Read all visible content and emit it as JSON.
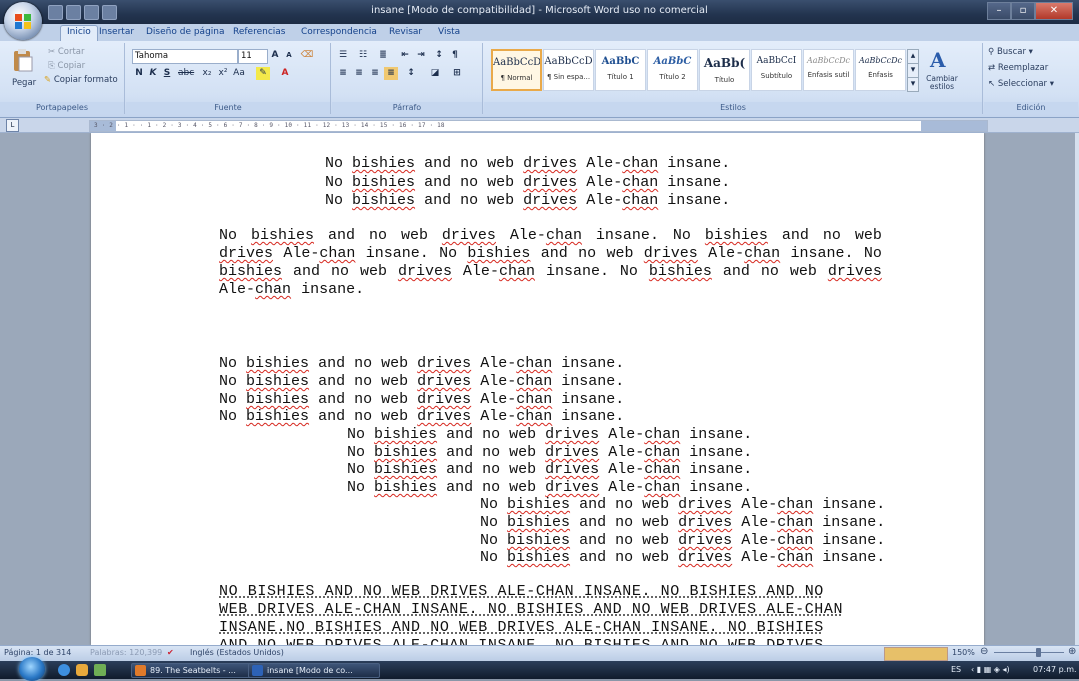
{
  "window": {
    "title": "insane [Modo de compatibilidad] - Microsoft Word uso no comercial",
    "controls": [
      "minimize-icon",
      "maximize-icon",
      "close-icon"
    ]
  },
  "tabs": [
    {
      "label": "Inicio",
      "active": true
    },
    {
      "label": "Insertar"
    },
    {
      "label": "Diseño de página"
    },
    {
      "label": "Referencias"
    },
    {
      "label": "Correspondencia"
    },
    {
      "label": "Revisar"
    },
    {
      "label": "Vista"
    }
  ],
  "ribbon": {
    "clipboard": {
      "paste": "Pegar",
      "cut": "Cortar",
      "copy": "Copiar",
      "format_painter": "Copiar formato",
      "group": "Portapapeles"
    },
    "font": {
      "family": "Tahoma",
      "size": "11",
      "bold": "N",
      "italic": "K",
      "underline": "S",
      "group": "Fuente"
    },
    "paragraph": {
      "group": "Párrafo"
    },
    "styles": {
      "items": [
        {
          "sample": "AaBbCcD",
          "name": "¶ Normal",
          "selected": true
        },
        {
          "sample": "AaBbCcD",
          "name": "¶ Sin espa..."
        },
        {
          "sample": "AaBbC",
          "name": "Título 1"
        },
        {
          "sample": "AaBbC",
          "name": "Título 2"
        },
        {
          "sample": "AaBb(",
          "name": "Título"
        },
        {
          "sample": "AaBbCcI",
          "name": "Subtítulo"
        },
        {
          "sample": "AaBbCcDc",
          "name": "Énfasis sutil"
        },
        {
          "sample": "AaBbCcDc",
          "name": "Énfasis"
        }
      ],
      "change": "Cambiar estilos",
      "group": "Estilos"
    },
    "editing": {
      "find": "Buscar",
      "replace": "Reemplazar",
      "select": "Seleccionar",
      "group": "Edición"
    }
  },
  "ruler": {
    "marks": "3 · 2 · 1 · · 1 · 2 · 3 · 4 · 5 · 6 · 7 · 8 · 9 · 10 · 11 · 12 · 13 · 14 · 15 · 16 · 17 · 18"
  },
  "document": {
    "line": "No bishies and no web drives Ale-chan insane.",
    "paragraph": "No bishies and no web drives Ale-chan insane. No bishies and no web drives Ale-chan insane. No bishies and no web drives Ale-chan insane. No bishies and no web drives Ale-chan insane. No bishies and no web drives Ale-chan insane.",
    "upper_lines": [
      "NO BISHIES AND NO WEB DRIVES ALE-CHAN INSANE. NO BISHIES AND NO",
      "WEB DRIVES ALE-CHAN INSANE. NO BISHIES AND NO WEB DRIVES ALE-CHAN",
      "INSANE.NO BISHIES AND NO WEB DRIVES ALE-CHAN INSANE. NO BISHIES",
      "AND NO WEB DRIVES ALE-CHAN INSANE. NO BISHIES AND NO WEB DRIVES"
    ]
  },
  "status": {
    "page": "Página: 1 de 314",
    "words": "Palabras: 120,399",
    "language": "Inglés (Estados Unidos)",
    "zoom": "150%"
  },
  "taskbar": {
    "items": [
      "89. The Seatbelts - ...",
      "insane [Modo de co..."
    ],
    "lang": "ES",
    "time": "07:47 p.m."
  }
}
